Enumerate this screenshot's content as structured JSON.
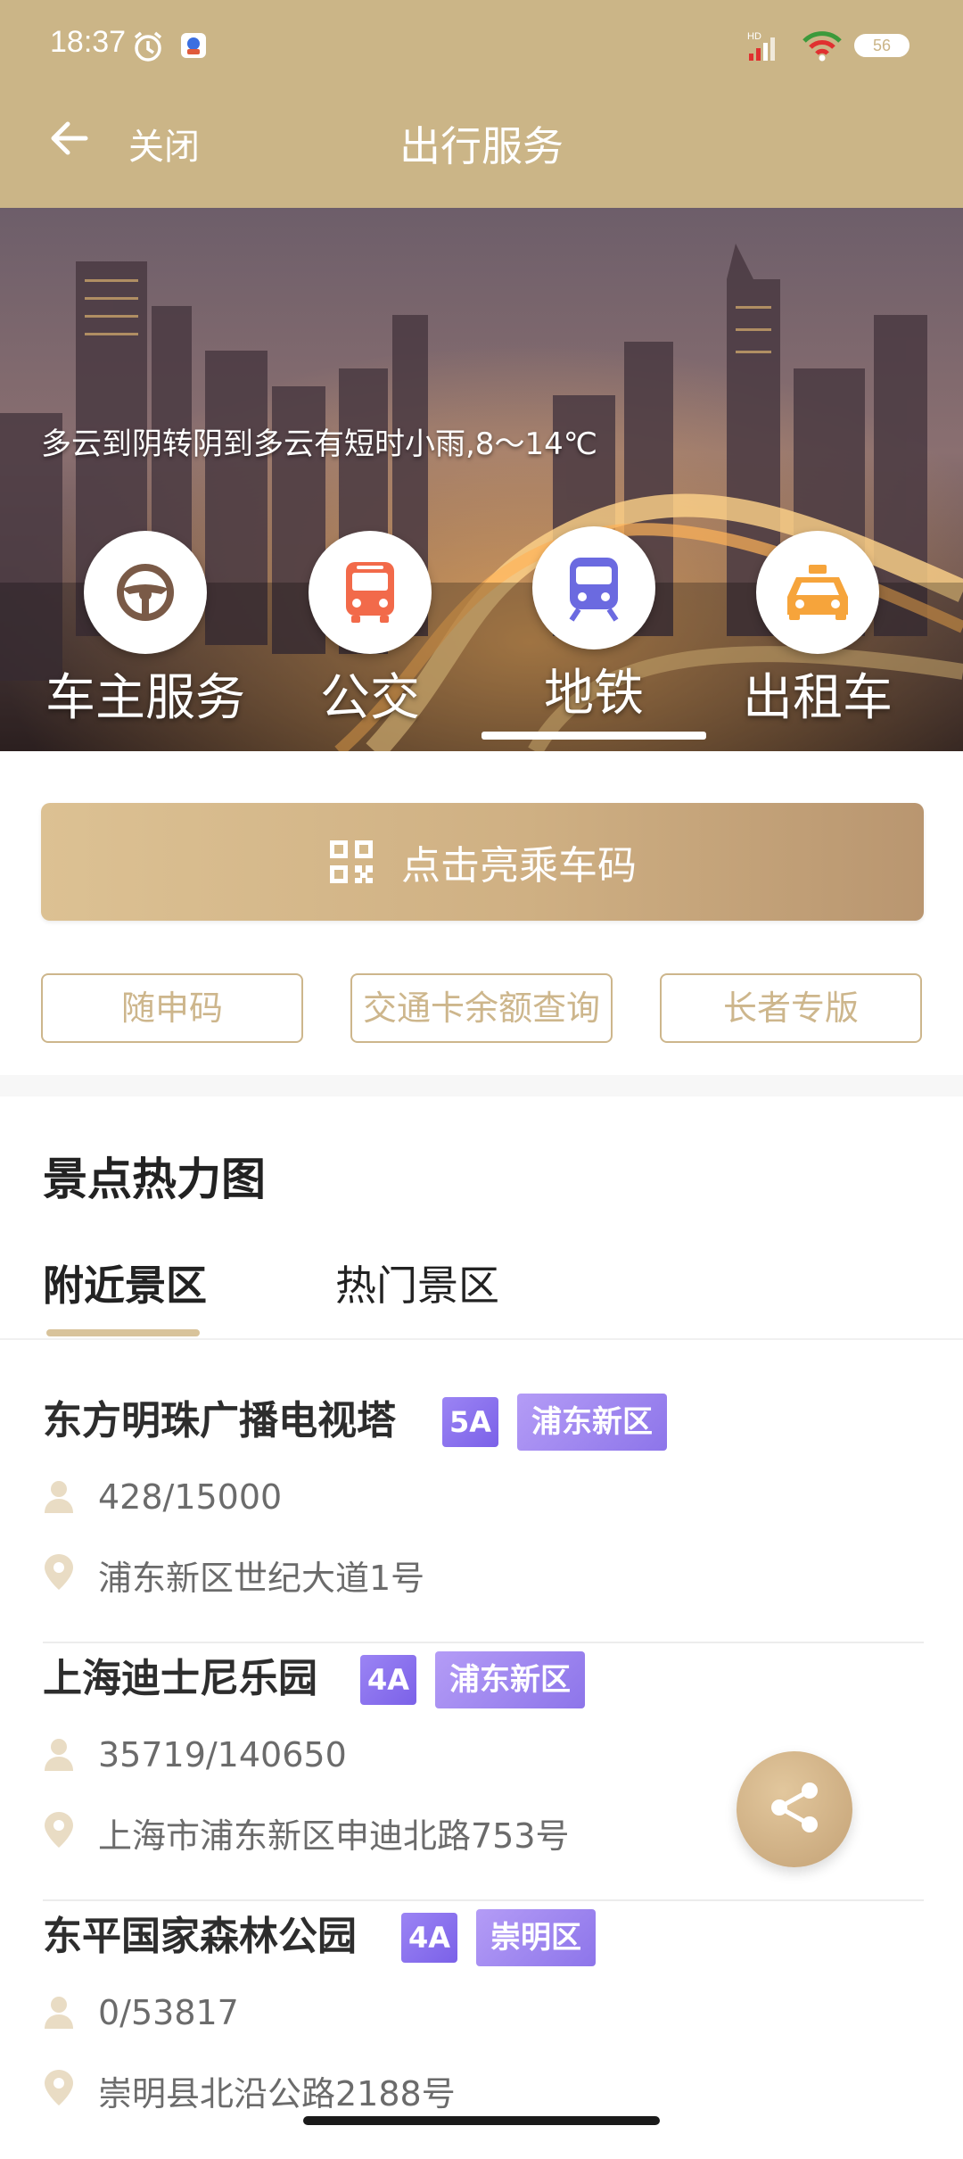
{
  "status_bar": {
    "time": "18:37",
    "network": "HD",
    "battery": "56"
  },
  "nav": {
    "close_label": "关闭",
    "title": "出行服务"
  },
  "hero": {
    "weather": "多云到阴转阴到多云有短时小雨,8～14℃",
    "services": [
      {
        "label": "车主服务",
        "icon": "steering-wheel-icon",
        "color": "#7a5a47"
      },
      {
        "label": "公交",
        "icon": "bus-icon",
        "color": "#f26a4a"
      },
      {
        "label": "地铁",
        "icon": "metro-icon",
        "color": "#6b6ae0",
        "active": true
      },
      {
        "label": "出租车",
        "icon": "taxi-icon",
        "color": "#f6a43b"
      }
    ]
  },
  "qr_button": {
    "label": "点击亮乘车码"
  },
  "quick_buttons": [
    "随申码",
    "交通卡余额查询",
    "长者专版"
  ],
  "heatmap": {
    "title": "景点热力图",
    "tabs": [
      "附近景区",
      "热门景区"
    ],
    "items": [
      {
        "name": "东方明珠广播电视塔",
        "grade": "5A",
        "district": "浦东新区",
        "visitors": "428/15000",
        "address": "浦东新区世纪大道1号"
      },
      {
        "name": "上海迪士尼乐园",
        "grade": "4A",
        "district": "浦东新区",
        "visitors": "35719/140650",
        "address": "上海市浦东新区申迪北路753号"
      },
      {
        "name": "东平国家森林公园",
        "grade": "4A",
        "district": "崇明区",
        "visitors": "0/53817",
        "address": "崇明县北沿公路2188号"
      }
    ]
  },
  "colors": {
    "brand": "#cbb587",
    "badge": "#8d75ea"
  }
}
